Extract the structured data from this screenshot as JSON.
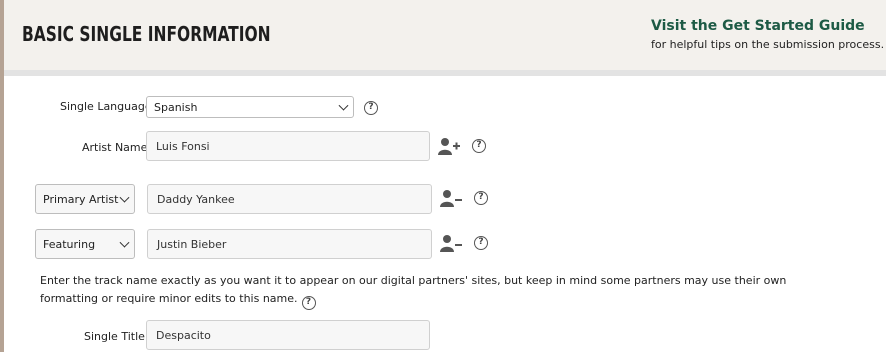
{
  "header": {
    "title": "BASIC SINGLE INFORMATION",
    "guide_link": "Visit the Get Started Guide",
    "guide_subtitle": "for helpful tips on the submission process."
  },
  "form": {
    "language": {
      "label": "Single Language",
      "value": "Spanish"
    },
    "artist": {
      "label": "Artist Name",
      "value": "Luis Fonsi"
    },
    "additional_artists": [
      {
        "role": "Primary Artist",
        "name": "Daddy Yankee"
      },
      {
        "role": "Featuring",
        "name": "Justin Bieber"
      }
    ],
    "track_note": "Enter the track name exactly as you want it to appear on our digital partners' sites, but keep in mind some partners may use their own formatting or require minor edits to this name.",
    "title": {
      "label": "Single Title",
      "value": "Despacito"
    }
  },
  "icons": {
    "help": "question-circle-icon",
    "add_artist": "user-plus-icon",
    "remove_artist": "user-minus-icon"
  },
  "help_glyph": "?",
  "colors": {
    "header_bg": "#f3f1ed",
    "guide_link": "#1d5a45",
    "left_rail": "#b5a394",
    "input_bg": "#f7f7f7"
  }
}
